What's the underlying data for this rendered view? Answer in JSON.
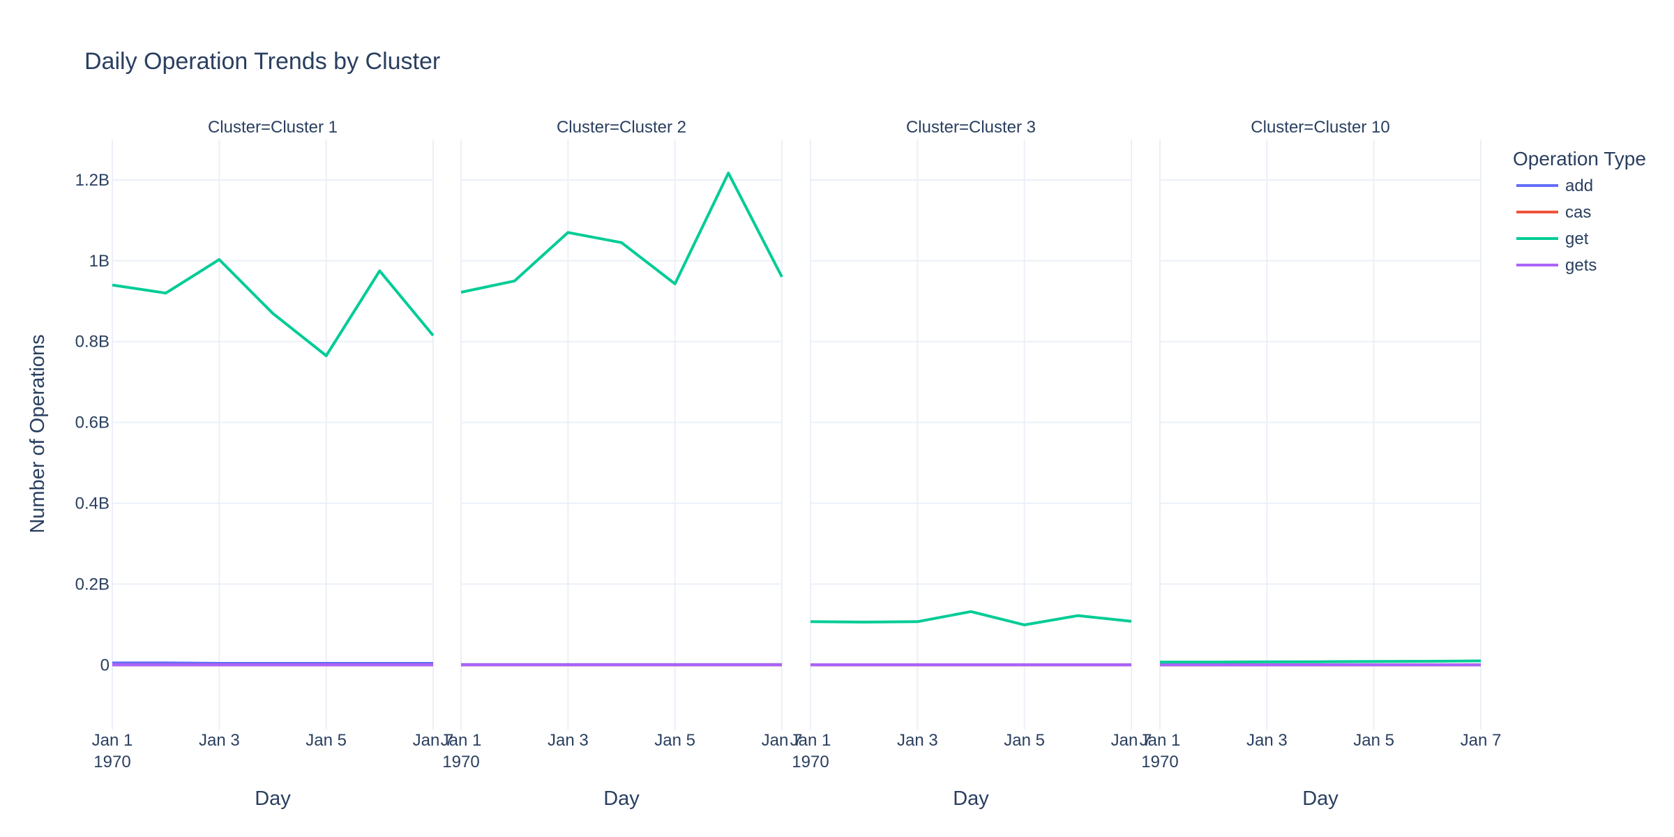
{
  "chart_data": {
    "type": "line",
    "title": "Daily Operation Trends by Cluster",
    "ylabel": "Number of Operations",
    "xlabel": "Day",
    "legend_title": "Operation Type",
    "legend_position": "right",
    "grid": true,
    "ylim": [
      -160000000,
      1300000000
    ],
    "xlim": [
      "1970-01-01",
      "1970-01-07"
    ],
    "y_ticks": [
      {
        "value": 0,
        "label": "0"
      },
      {
        "value": 200000000,
        "label": "0.2B"
      },
      {
        "value": 400000000,
        "label": "0.4B"
      },
      {
        "value": 600000000,
        "label": "0.6B"
      },
      {
        "value": 800000000,
        "label": "0.8B"
      },
      {
        "value": 1000000000,
        "label": "1B"
      },
      {
        "value": 1200000000,
        "label": "1.2B"
      }
    ],
    "x_ticks": [
      {
        "date": "1970-01-01",
        "label": "Jan 1",
        "sublabel": "1970"
      },
      {
        "date": "1970-01-03",
        "label": "Jan 3",
        "sublabel": ""
      },
      {
        "date": "1970-01-05",
        "label": "Jan 5",
        "sublabel": ""
      },
      {
        "date": "1970-01-07",
        "label": "Jan 7",
        "sublabel": ""
      }
    ],
    "x": [
      "1970-01-01",
      "1970-01-02",
      "1970-01-03",
      "1970-01-04",
      "1970-01-05",
      "1970-01-06",
      "1970-01-07"
    ],
    "legend": [
      {
        "name": "add",
        "color": "#636efa"
      },
      {
        "name": "cas",
        "color": "#ef553b"
      },
      {
        "name": "get",
        "color": "#00cc96"
      },
      {
        "name": "gets",
        "color": "#ab63fa"
      }
    ],
    "panels": [
      {
        "title": "Cluster=Cluster 1",
        "series": [
          {
            "name": "add",
            "color": "#636efa",
            "values": [
              5000000,
              5000000,
              4000000,
              4000000,
              4000000,
              4000000,
              4000000
            ]
          },
          {
            "name": "cas",
            "color": "#ef553b",
            "values": [
              0,
              0,
              0,
              0,
              0,
              0,
              0
            ]
          },
          {
            "name": "get",
            "color": "#00cc96",
            "values": [
              940000000,
              920000000,
              1003000000,
              870000000,
              765000000,
              975000000,
              815000000
            ]
          },
          {
            "name": "gets",
            "color": "#ab63fa",
            "values": [
              0,
              0,
              0,
              0,
              0,
              0,
              0
            ]
          }
        ]
      },
      {
        "title": "Cluster=Cluster 2",
        "series": [
          {
            "name": "add",
            "color": "#636efa",
            "values": [
              1000000,
              1000000,
              1000000,
              1000000,
              1000000,
              1000000,
              1000000
            ]
          },
          {
            "name": "cas",
            "color": "#ef553b",
            "values": [
              0,
              0,
              0,
              0,
              0,
              0,
              0
            ]
          },
          {
            "name": "get",
            "color": "#00cc96",
            "values": [
              922000000,
              950000000,
              1070000000,
              1045000000,
              943000000,
              1217000000,
              960000000
            ]
          },
          {
            "name": "gets",
            "color": "#ab63fa",
            "values": [
              0,
              0,
              0,
              0,
              0,
              0,
              0
            ]
          }
        ]
      },
      {
        "title": "Cluster=Cluster 3",
        "series": [
          {
            "name": "add",
            "color": "#636efa",
            "values": [
              500000,
              500000,
              500000,
              500000,
              500000,
              500000,
              500000
            ]
          },
          {
            "name": "cas",
            "color": "#ef553b",
            "values": [
              0,
              0,
              0,
              0,
              0,
              0,
              0
            ]
          },
          {
            "name": "get",
            "color": "#00cc96",
            "values": [
              107000000,
              106000000,
              107000000,
              132000000,
              99000000,
              122000000,
              108000000
            ]
          },
          {
            "name": "gets",
            "color": "#ab63fa",
            "values": [
              0,
              0,
              0,
              0,
              0,
              0,
              0
            ]
          }
        ]
      },
      {
        "title": "Cluster=Cluster 10",
        "series": [
          {
            "name": "add",
            "color": "#636efa",
            "values": [
              300000,
              300000,
              300000,
              300000,
              300000,
              300000,
              300000
            ]
          },
          {
            "name": "cas",
            "color": "#ef553b",
            "values": [
              0,
              0,
              0,
              0,
              0,
              0,
              0
            ]
          },
          {
            "name": "get",
            "color": "#00cc96",
            "values": [
              7000000,
              7000000,
              7500000,
              8000000,
              8500000,
              9000000,
              10000000
            ]
          },
          {
            "name": "gets",
            "color": "#ab63fa",
            "values": [
              0,
              0,
              0,
              0,
              0,
              0,
              0
            ]
          }
        ]
      }
    ]
  }
}
